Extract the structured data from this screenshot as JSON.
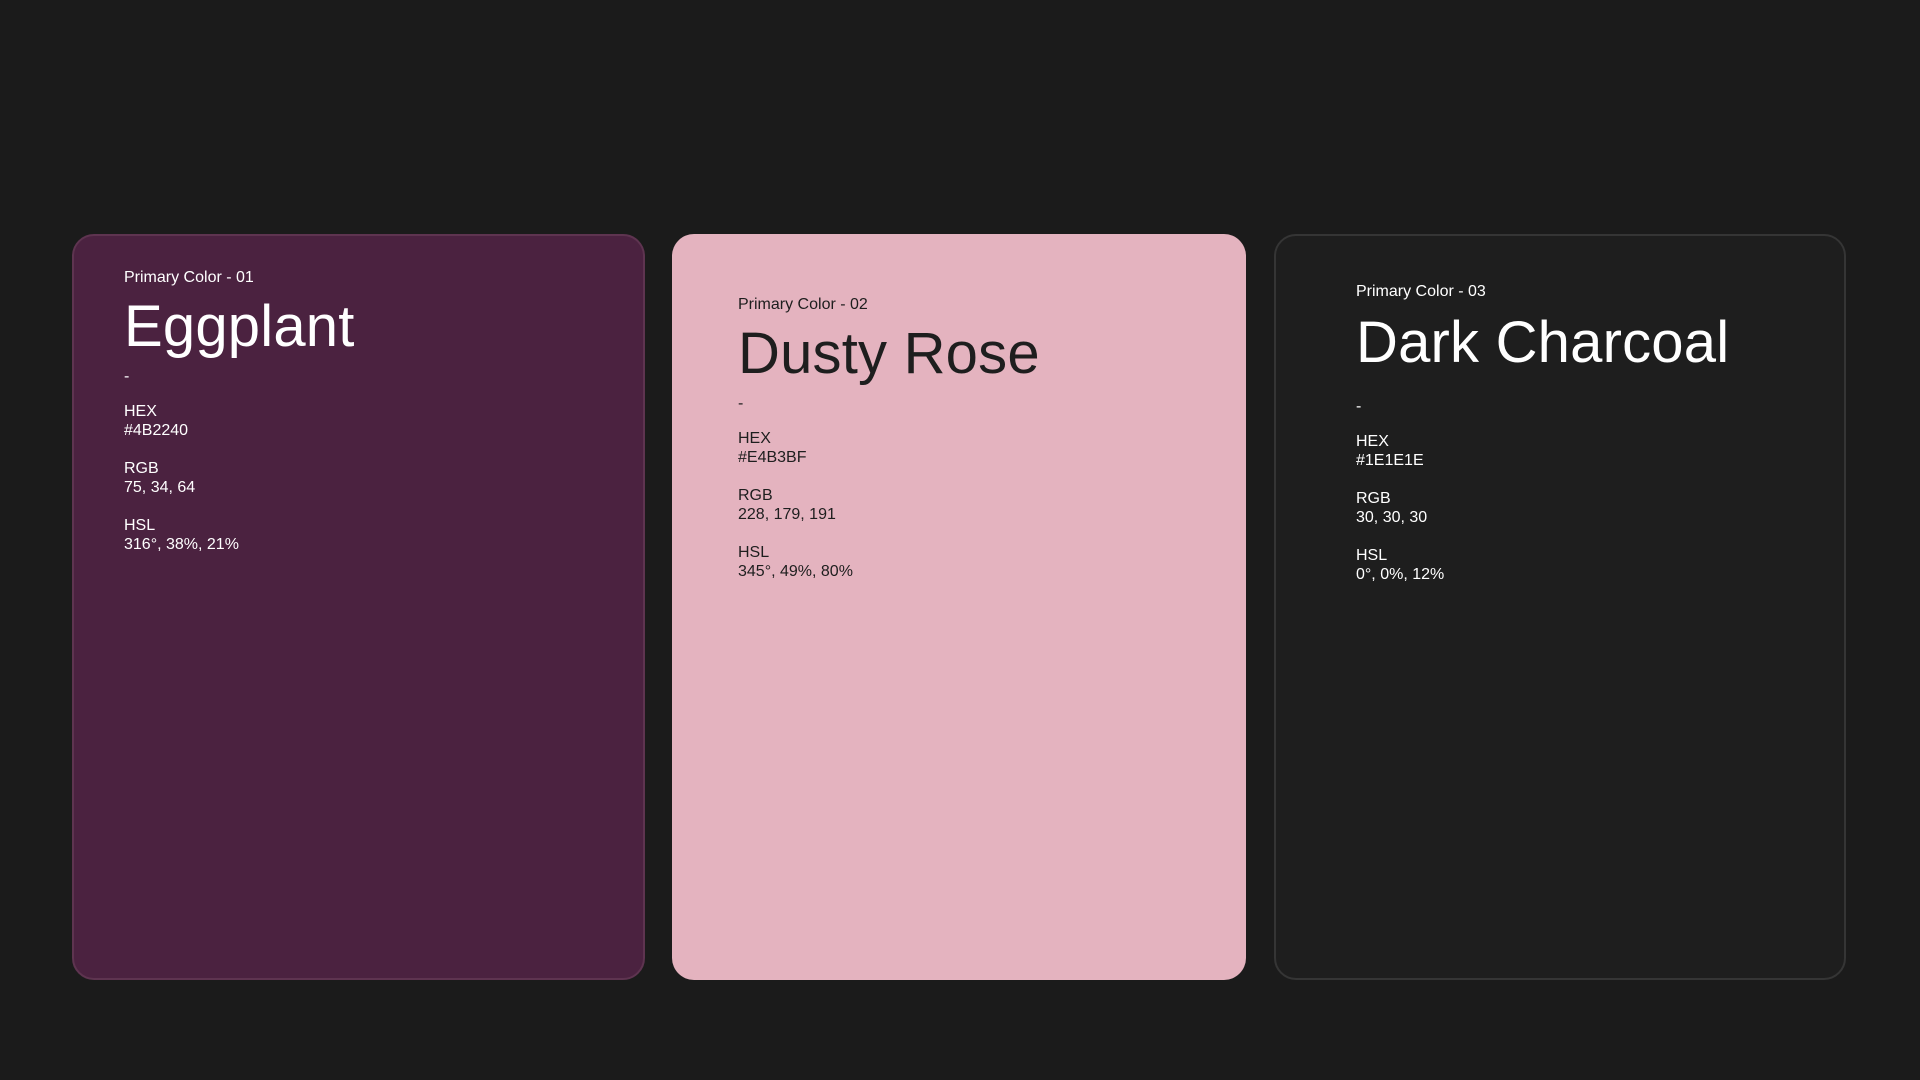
{
  "cards": [
    {
      "label": "Primary Color - 01",
      "name": "Eggplant",
      "dash": "-",
      "background": "#4B2240",
      "text_color": "#FFFFFF",
      "specs": [
        {
          "key": "HEX",
          "value": "#4B2240"
        },
        {
          "key": "RGB",
          "value": "75, 34, 64"
        },
        {
          "key": "HSL",
          "value": "316°, 38%, 21%"
        }
      ]
    },
    {
      "label": "Primary Color - 02",
      "name": "Dusty Rose",
      "dash": "-",
      "background": "#E4B3BF",
      "text_color": "#1E1E1E",
      "specs": [
        {
          "key": "HEX",
          "value": "#E4B3BF"
        },
        {
          "key": "RGB",
          "value": "228, 179, 191"
        },
        {
          "key": "HSL",
          "value": "345°, 49%, 80%"
        }
      ]
    },
    {
      "label": "Primary Color - 03",
      "name": "Dark Charcoal",
      "dash": "-",
      "background": "#1E1E1E",
      "text_color": "#FFFFFF",
      "specs": [
        {
          "key": "HEX",
          "value": "#1E1E1E"
        },
        {
          "key": "RGB",
          "value": "30, 30, 30"
        },
        {
          "key": "HSL",
          "value": "0°, 0%, 12%"
        }
      ]
    }
  ]
}
